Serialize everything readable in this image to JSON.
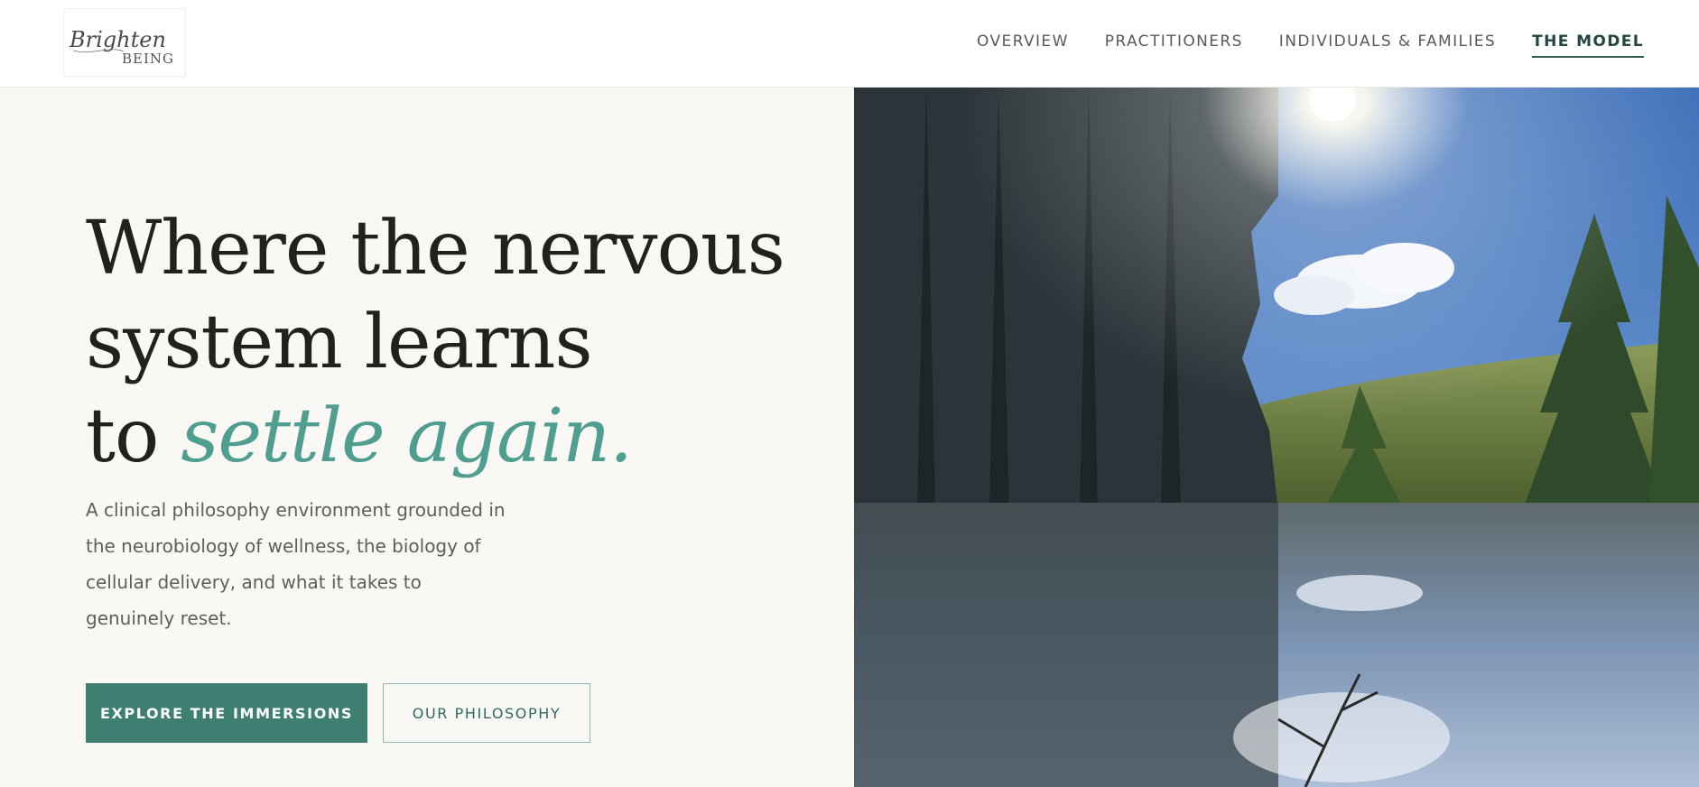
{
  "logo": {
    "line1": "Brighten",
    "line2": "BEING",
    "icon": "brighten-being-logo"
  },
  "nav": {
    "items": [
      {
        "label": "OVERVIEW"
      },
      {
        "label": "PRACTITIONERS"
      },
      {
        "label": "INDIVIDUALS & FAMILIES"
      },
      {
        "label": "THE MODEL",
        "active": true
      }
    ]
  },
  "hero": {
    "headline_line1": "Where the nervous",
    "headline_line2": "system learns",
    "headline_line3_prefix": "to",
    "headline_line3_accent": "settle again.",
    "description": "A clinical philosophy environment grounded in the neurobiology of wellness, the biology of cellular delivery, and what it takes to genuinely reset.",
    "primary_button": "EXPLORE THE IMMERSIONS",
    "secondary_button": "OUR PHILOSOPHY",
    "image_icon": "forest-pond-photo"
  },
  "colors": {
    "accent": "#4f9e90",
    "button_primary": "#3f7f72",
    "nav_active": "#23463f",
    "background": "#f9f8f4"
  }
}
